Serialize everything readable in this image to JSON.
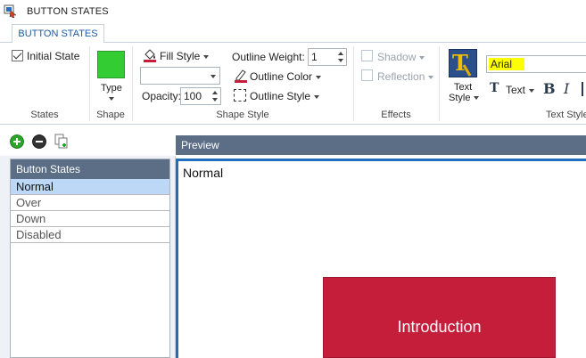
{
  "window": {
    "title": "BUTTON STATES"
  },
  "tabs": [
    {
      "label": "BUTTON STATES",
      "active": true
    }
  ],
  "ribbon": {
    "states_group": {
      "label": "States",
      "initial_state_label": "Initial State",
      "initial_state_checked": true
    },
    "shape_group": {
      "label": "Shape",
      "type_label": "Type",
      "fill_color": "#33cc33"
    },
    "shape_style_group": {
      "label": "Shape Style",
      "fill_style_label": "Fill Style",
      "fill_style_value": "",
      "opacity_label": "Opacity:",
      "opacity_value": "100",
      "outline_weight_label": "Outline Weight:",
      "outline_weight_value": "1",
      "outline_color_label": "Outline Color",
      "outline_style_label": "Outline Style"
    },
    "effects_group": {
      "label": "Effects",
      "shadow_label": "Shadow",
      "reflection_label": "Reflection"
    },
    "text_style_group": {
      "label": "Text Style",
      "text_style_line1": "Text",
      "text_style_line2": "Style",
      "font_name": "Arial",
      "text_label": "Text",
      "bold_label": "B",
      "italic_label": "I",
      "highlight_color": "#ffff00"
    }
  },
  "states_panel": {
    "header": "Button States",
    "items": [
      {
        "label": "Normal",
        "selected": true
      },
      {
        "label": "Over",
        "selected": false
      },
      {
        "label": "Down",
        "selected": false
      },
      {
        "label": "Disabled",
        "selected": false
      }
    ]
  },
  "preview": {
    "header": "Preview",
    "state_label": "Normal",
    "button_label": "Introduction",
    "button_color": "#c41e3a",
    "border_color": "#1f6fbd"
  },
  "icons": {
    "app": "app-icon",
    "add": "add-icon",
    "remove": "remove-icon",
    "duplicate": "duplicate-icon",
    "fill": "paint-bucket-icon",
    "outline_color": "pen-icon",
    "text_style": "text-style-icon"
  }
}
